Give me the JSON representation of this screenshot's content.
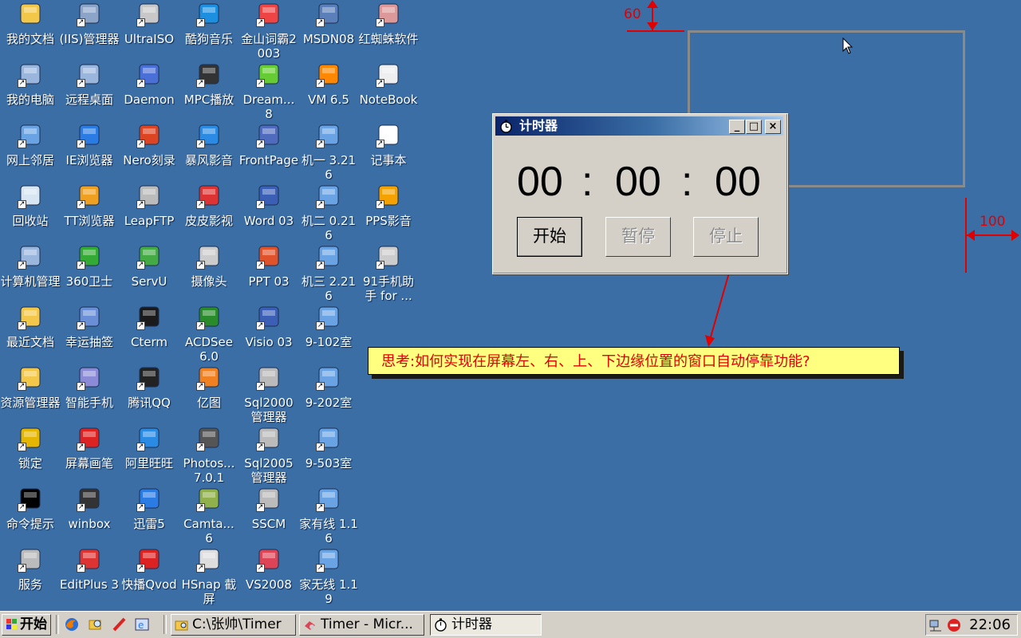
{
  "desktop": {
    "icons": [
      {
        "label": "我的文档",
        "icon": "my-documents-icon",
        "color": "#f3c84a"
      },
      {
        "label": "(IIS)管理器",
        "icon": "iis-manager-icon",
        "color": "#8da4c9"
      },
      {
        "label": "UltraISO",
        "icon": "ultraiso-icon",
        "color": "#c8c8c8"
      },
      {
        "label": "酷狗音乐",
        "icon": "kugou-icon",
        "color": "#1d8fe1"
      },
      {
        "label": "金山词霸2003",
        "icon": "kingsoft-icon",
        "color": "#e44"
      },
      {
        "label": "MSDN08",
        "icon": "msdn-icon",
        "color": "#5b7fb9"
      },
      {
        "label": "红蜘蛛软件",
        "icon": "redspider-icon",
        "color": "#d99"
      },
      {
        "label": "我的电脑",
        "icon": "my-computer-icon",
        "color": "#9ab6dd"
      },
      {
        "label": "远程桌面",
        "icon": "remote-desktop-icon",
        "color": "#9ab6dd"
      },
      {
        "label": "Daemon",
        "icon": "daemon-icon",
        "color": "#4a6fd6"
      },
      {
        "label": "MPC播放",
        "icon": "mpc-icon",
        "color": "#333"
      },
      {
        "label": "Dream... 8",
        "icon": "dreamweaver-icon",
        "color": "#6c3"
      },
      {
        "label": "VM 6.5",
        "icon": "vmware-icon",
        "color": "#f80"
      },
      {
        "label": "NoteBook",
        "icon": "notebook-icon",
        "color": "#eee"
      },
      {
        "label": "网上邻居",
        "icon": "network-icon",
        "color": "#6aa3e3"
      },
      {
        "label": "IE浏览器",
        "icon": "ie-icon",
        "color": "#2a7be4"
      },
      {
        "label": "Nero刻录",
        "icon": "nero-icon",
        "color": "#d42"
      },
      {
        "label": "暴风影音",
        "icon": "baofeng-icon",
        "color": "#2b8be4"
      },
      {
        "label": "FrontPage",
        "icon": "frontpage-icon",
        "color": "#4f6bbd"
      },
      {
        "label": "机一 3.216",
        "icon": "network-pc-icon",
        "color": "#6aa3e3"
      },
      {
        "label": "记事本",
        "icon": "notepad-icon",
        "color": "#fff"
      },
      {
        "label": "回收站",
        "icon": "recycle-bin-icon",
        "color": "#d7e6f2"
      },
      {
        "label": "TT浏览器",
        "icon": "tt-browser-icon",
        "color": "#f0a020"
      },
      {
        "label": "LeapFTP",
        "icon": "leapftp-icon",
        "color": "#bbb"
      },
      {
        "label": "皮皮影视",
        "icon": "pipi-icon",
        "color": "#d33"
      },
      {
        "label": "Word 03",
        "icon": "word-icon",
        "color": "#3a5fb5"
      },
      {
        "label": "机二 0.216",
        "icon": "network-pc-icon",
        "color": "#6aa3e3"
      },
      {
        "label": "PPS影音",
        "icon": "pps-icon",
        "color": "#f5a100"
      },
      {
        "label": "计算机管理",
        "icon": "computer-management-icon",
        "color": "#9ab6dd"
      },
      {
        "label": "360卫士",
        "icon": "360-icon",
        "color": "#3a3"
      },
      {
        "label": "ServU",
        "icon": "servu-icon",
        "color": "#4a4"
      },
      {
        "label": "摄像头",
        "icon": "camera-icon",
        "color": "#ccc"
      },
      {
        "label": "PPT 03",
        "icon": "powerpoint-icon",
        "color": "#e0522a"
      },
      {
        "label": "机三 2.216",
        "icon": "network-pc-icon",
        "color": "#6aa3e3"
      },
      {
        "label": "91手机助手 for ...",
        "icon": "91-assistant-icon",
        "color": "#ccc"
      },
      {
        "label": "最近文档",
        "icon": "recent-docs-icon",
        "color": "#f3c84a"
      },
      {
        "label": "幸运抽签",
        "icon": "lucky-draw-icon",
        "color": "#6a8fd6"
      },
      {
        "label": "Cterm",
        "icon": "cterm-icon",
        "color": "#1a1a1a"
      },
      {
        "label": "ACDSee 6.0",
        "icon": "acdsee-icon",
        "color": "#2a8b2a"
      },
      {
        "label": "Visio 03",
        "icon": "visio-icon",
        "color": "#3a5fb5"
      },
      {
        "label": "9-102室",
        "icon": "network-pc-icon",
        "color": "#6aa3e3"
      },
      {
        "label": "",
        "icon": "",
        "color": ""
      },
      {
        "label": "资源管理器",
        "icon": "explorer-icon",
        "color": "#f3c84a"
      },
      {
        "label": "智能手机",
        "icon": "smartphone-icon",
        "color": "#8a8ad6"
      },
      {
        "label": "腾讯QQ",
        "icon": "qq-icon",
        "color": "#222"
      },
      {
        "label": "亿图",
        "icon": "edraw-icon",
        "color": "#f08020"
      },
      {
        "label": "Sql2000管理器",
        "icon": "sql2000-icon",
        "color": "#bbb"
      },
      {
        "label": "9-202室",
        "icon": "network-pc-icon",
        "color": "#6aa3e3"
      },
      {
        "label": "",
        "icon": "",
        "color": ""
      },
      {
        "label": "锁定",
        "icon": "lock-icon",
        "color": "#e5b600"
      },
      {
        "label": "屏幕画笔",
        "icon": "screen-pen-icon",
        "color": "#d22"
      },
      {
        "label": "阿里旺旺",
        "icon": "wangwang-icon",
        "color": "#2a8be4"
      },
      {
        "label": "Photos... 7.0.1",
        "icon": "photoshop-icon",
        "color": "#555"
      },
      {
        "label": "Sql2005管理器",
        "icon": "sql2005-icon",
        "color": "#bbb"
      },
      {
        "label": "9-503室",
        "icon": "network-pc-icon",
        "color": "#6aa3e3"
      },
      {
        "label": "",
        "icon": "",
        "color": ""
      },
      {
        "label": "命令提示",
        "icon": "cmd-icon",
        "color": "#000"
      },
      {
        "label": "winbox",
        "icon": "winbox-icon",
        "color": "#333"
      },
      {
        "label": "迅雷5",
        "icon": "thunder-icon",
        "color": "#2a7be4"
      },
      {
        "label": "Camta... 6",
        "icon": "camtasia-icon",
        "color": "#8fb04a"
      },
      {
        "label": "SSCM",
        "icon": "sscm-icon",
        "color": "#bbb"
      },
      {
        "label": "家有线 1.16",
        "icon": "network-pc-icon",
        "color": "#6aa3e3"
      },
      {
        "label": "",
        "icon": "",
        "color": ""
      },
      {
        "label": "服务",
        "icon": "services-icon",
        "color": "#bbb"
      },
      {
        "label": "EditPlus 3",
        "icon": "editplus-icon",
        "color": "#d33"
      },
      {
        "label": "快播Qvod",
        "icon": "qvod-icon",
        "color": "#d22"
      },
      {
        "label": "HSnap 截屏",
        "icon": "hsnap-icon",
        "color": "#ddd"
      },
      {
        "label": "VS2008",
        "icon": "vs2008-icon",
        "color": "#d45"
      },
      {
        "label": "家无线 1.19",
        "icon": "network-pc-icon",
        "color": "#6aa3e3"
      },
      {
        "label": "",
        "icon": "",
        "color": ""
      }
    ]
  },
  "timer_window": {
    "title": "计时器",
    "hours": "00",
    "minutes": "00",
    "seconds": "00",
    "sep1": ":",
    "sep2": ":",
    "start_label": "开始",
    "pause_label": "暂停",
    "stop_label": "停止",
    "minimize": "_",
    "maximize": "□",
    "close": "×"
  },
  "annotations": {
    "top_value": "60",
    "right_value": "100",
    "tip": "思考:如何实现在屏幕左、右、上、下边缘位置的窗口自动停靠功能?",
    "color": "#e00000"
  },
  "taskbar": {
    "start_label": "开始",
    "tasks": [
      {
        "label": "C:\\张帅\\Timer",
        "icon": "folder-icon"
      },
      {
        "label": "Timer - Micr...",
        "icon": "visual-studio-icon"
      },
      {
        "label": "计时器",
        "icon": "stopwatch-icon"
      }
    ],
    "clock": "22:06"
  }
}
